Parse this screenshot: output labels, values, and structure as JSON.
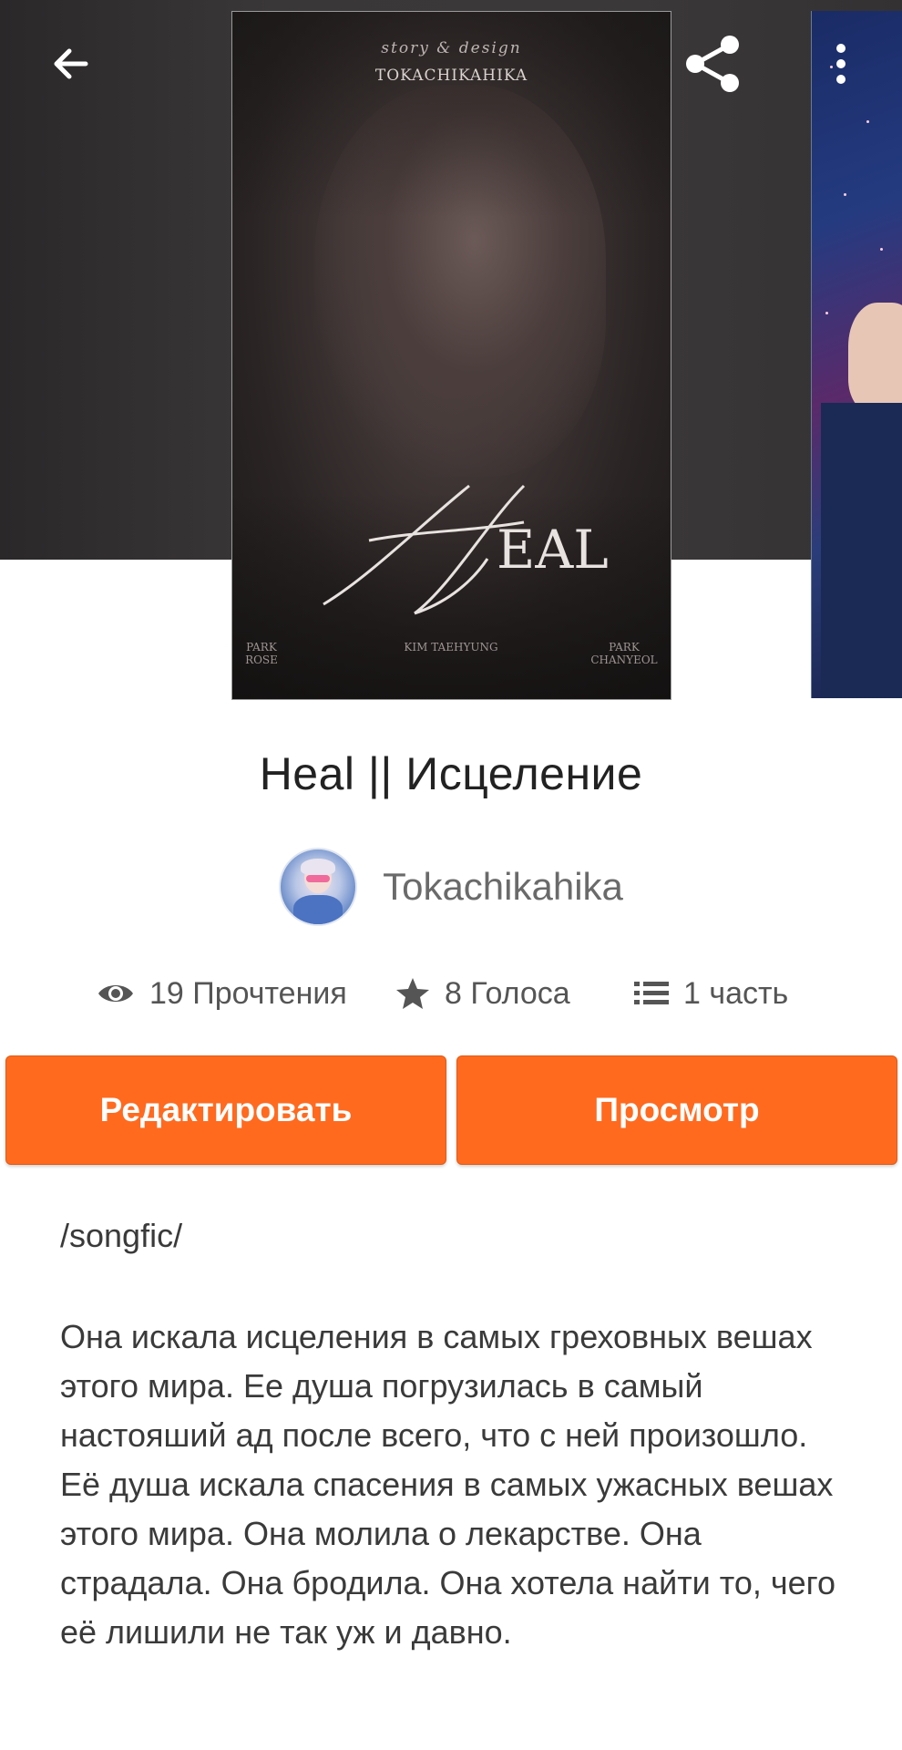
{
  "header": {
    "back_icon": "arrow-left-icon",
    "share_icon": "share-icon",
    "more_icon": "more-vertical-icon"
  },
  "cover": {
    "script_text": "story & design",
    "author_text": "TOKACHIKAHIKA",
    "title_text": "EAL",
    "names": [
      "PARK ROSE",
      "KIM TAEHYUNG",
      "PARK CHANYEOL"
    ]
  },
  "story": {
    "title": "Heal || Исцеление",
    "author": "Tokachikahika"
  },
  "stats": {
    "reads": "19 Прочтения",
    "votes": "8 Голоса",
    "parts": "1 часть"
  },
  "buttons": {
    "edit": "Редактировать",
    "preview": "Просмотр"
  },
  "description": {
    "tag": "/songfic/",
    "text": "Она искала исцеления в самых греховных вешах этого мира. Ее душа погрузилась в самый настояший ад после всего, что с ней произошло. Её душа искала спасения в самых ужасных вешах этого мира. Она молила о лекарстве. Она страдала. Она бродила. Она хотела найти то, чего её лишили не так уж и давно."
  },
  "colors": {
    "accent": "#ff6a1f",
    "header_bg": "#3a3738"
  }
}
